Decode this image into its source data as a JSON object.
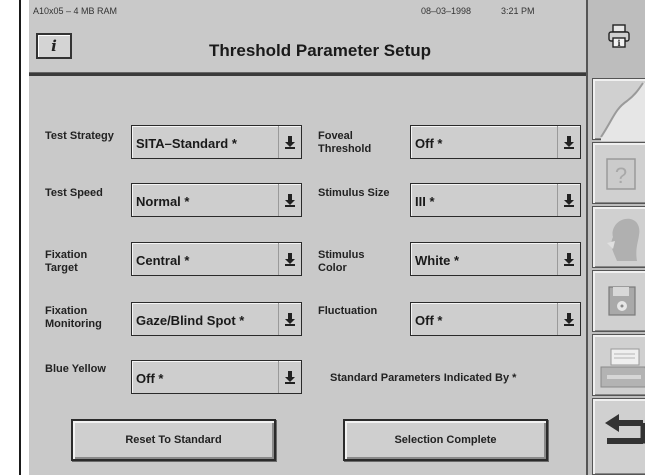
{
  "status_bar": {
    "system_info": "A10x05 – 4 MB RAM",
    "date": "08–03–1998",
    "time": "3:21 PM"
  },
  "header": {
    "info_button": "i",
    "title": "Threshold Parameter Setup"
  },
  "icons": {
    "printer": "printer-icon",
    "side_buttons": [
      "field-plot-icon",
      "help-icon",
      "patient-icon",
      "disk-icon",
      "printer-icon",
      "return-icon"
    ]
  },
  "form": {
    "test_strategy": {
      "label": "Test Strategy",
      "value": "SITA–Standard *"
    },
    "test_speed": {
      "label": "Test Speed",
      "value": "Normal *"
    },
    "fixation_target": {
      "label": "Fixation Target",
      "value": "Central *"
    },
    "fixation_monitoring": {
      "label": "Fixation Monitoring",
      "value": "Gaze/Blind Spot *"
    },
    "blue_yellow": {
      "label": "Blue Yellow",
      "value": "Off *"
    },
    "foveal_threshold": {
      "label": "Foveal Threshold",
      "value": "Off *"
    },
    "stimulus_size": {
      "label": "Stimulus Size",
      "value": "III *"
    },
    "stimulus_color": {
      "label": "Stimulus Color",
      "value": "White *"
    },
    "fluctuation": {
      "label": "Fluctuation",
      "value": "Off *"
    },
    "standard_note": "Standard Parameters Indicated By *"
  },
  "buttons": {
    "reset": "Reset To Standard",
    "complete": "Selection Complete"
  }
}
